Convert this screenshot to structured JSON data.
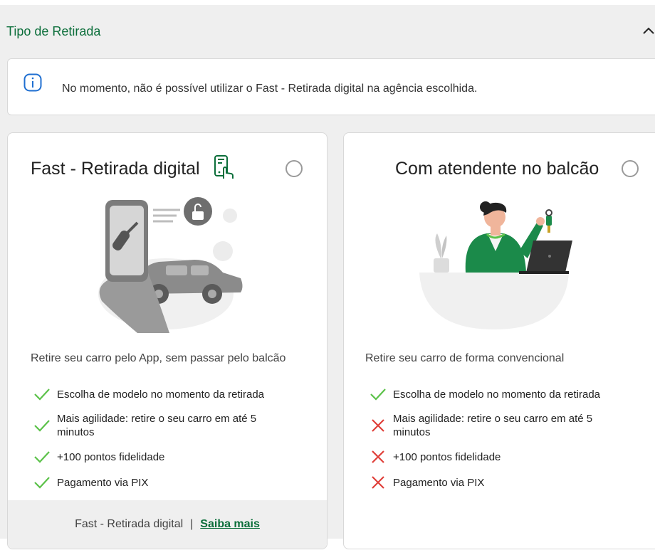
{
  "section": {
    "title": "Tipo de Retirada",
    "collapse_icon": "chevron-up-icon"
  },
  "info": {
    "icon": "info-icon",
    "text": "No momento, não é possível utilizar o Fast - Retirada digital na agência escolhida."
  },
  "cards": [
    {
      "title": "Fast - Retirada digital",
      "title_icon": "phone-touch-icon",
      "selected": false,
      "subtitle": "Retire seu carro pelo App, sem passar pelo balcão",
      "features": [
        {
          "text": "Escolha de modelo no momento da retirada",
          "available": true
        },
        {
          "text": "Mais agilidade: retire o seu carro em até 5 minutos",
          "available": true
        },
        {
          "text": "+100 pontos fidelidade",
          "available": true
        },
        {
          "text": "Pagamento via PIX",
          "available": true
        }
      ],
      "footer": {
        "text": "Fast - Retirada digital",
        "separator": "|",
        "link": "Saiba mais"
      }
    },
    {
      "title": "Com atendente no balcão",
      "selected": false,
      "subtitle": "Retire seu carro de forma convencional",
      "features": [
        {
          "text": "Escolha de modelo no momento da retirada",
          "available": true
        },
        {
          "text": "Mais agilidade: retire o seu carro em até 5 minutos",
          "available": false
        },
        {
          "text": "+100 pontos fidelidade",
          "available": false
        },
        {
          "text": "Pagamento via PIX",
          "available": false
        }
      ]
    }
  ],
  "colors": {
    "brand_green": "#0b6e3a",
    "check_green": "#5cc24a",
    "cross_red": "#e0403a",
    "panel_bg": "#efefef"
  }
}
